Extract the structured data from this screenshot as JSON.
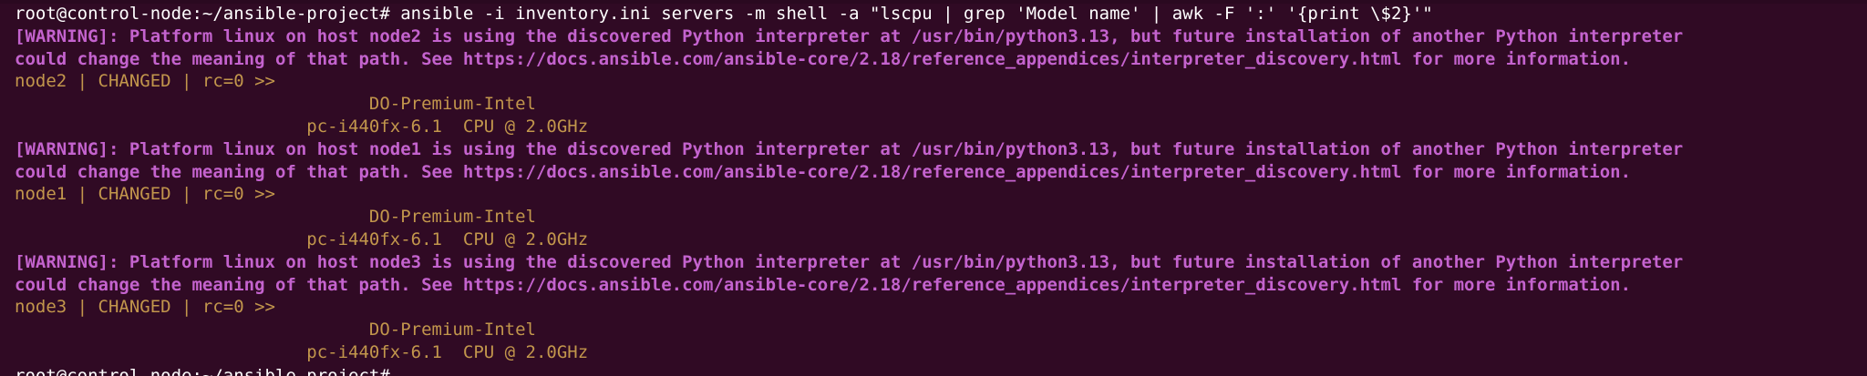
{
  "terminal": {
    "command_line": "root@control-node:~/ansible-project# ansible -i inventory.ini servers -m shell -a \"lscpu | grep 'Model name' | awk -F ':' '{print \\$2}'\"",
    "blocks": [
      {
        "warning_1": "[WARNING]: Platform linux on host node2 is using the discovered Python interpreter at /usr/bin/python3.13, but future installation of another Python interpreter",
        "warning_2": "could change the meaning of that path. See https://docs.ansible.com/ansible-core/2.18/reference_appendices/interpreter_discovery.html for more information.",
        "status": "node2 | CHANGED | rc=0 >>",
        "output_1": "                                  DO-Premium-Intel",
        "output_2": "                            pc-i440fx-6.1  CPU @ 2.0GHz"
      },
      {
        "warning_1": "[WARNING]: Platform linux on host node1 is using the discovered Python interpreter at /usr/bin/python3.13, but future installation of another Python interpreter",
        "warning_2": "could change the meaning of that path. See https://docs.ansible.com/ansible-core/2.18/reference_appendices/interpreter_discovery.html for more information.",
        "status": "node1 | CHANGED | rc=0 >>",
        "output_1": "                                  DO-Premium-Intel",
        "output_2": "                            pc-i440fx-6.1  CPU @ 2.0GHz"
      },
      {
        "warning_1": "[WARNING]: Platform linux on host node3 is using the discovered Python interpreter at /usr/bin/python3.13, but future installation of another Python interpreter",
        "warning_2": "could change the meaning of that path. See https://docs.ansible.com/ansible-core/2.18/reference_appendices/interpreter_discovery.html for more information.",
        "status": "node3 | CHANGED | rc=0 >>",
        "output_1": "                                  DO-Premium-Intel",
        "output_2": "                            pc-i440fx-6.1  CPU @ 2.0GHz"
      }
    ],
    "next_prompt": "root@control-node:~/ansible-project#"
  },
  "colors": {
    "background": "#300a24",
    "prompt": "#ffffff",
    "warning": "#c463ce",
    "host_output": "#c2964c"
  }
}
